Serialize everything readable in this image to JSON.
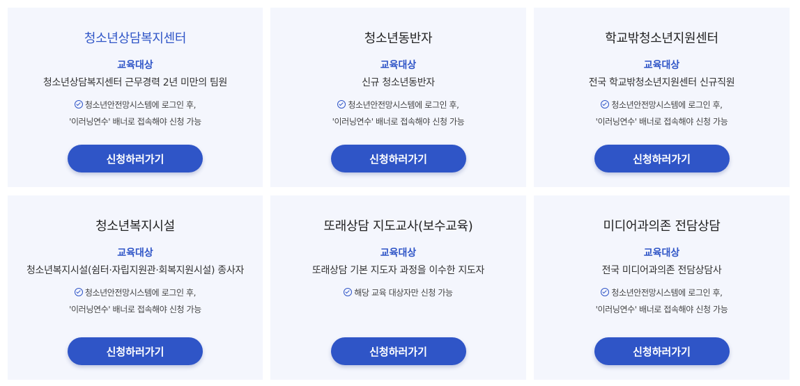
{
  "cards": [
    {
      "title": "청소년상담복지센터",
      "target_label": "교육대상",
      "target_desc": "청소년상담복지센터 근무경력 2년 미만의 팀원",
      "note_line1": "청소년안전망시스템에 로그인 후,",
      "note_line2": "'이러닝연수' 배너로 접속해야 신청 가능",
      "button": "신청하러가기"
    },
    {
      "title": "청소년동반자",
      "target_label": "교육대상",
      "target_desc": "신규 청소년동반자",
      "note_line1": "청소년안전망시스템에 로그인 후,",
      "note_line2": "'이러닝연수' 배너로 접속해야 신청 가능",
      "button": "신청하러가기"
    },
    {
      "title": "학교밖청소년지원센터",
      "target_label": "교육대상",
      "target_desc": "전국 학교밖청소년지원센터 신규직원",
      "note_line1": "청소년안전망시스템에 로그인 후,",
      "note_line2": "'이러닝연수' 배너로 접속해야 신청 가능",
      "button": "신청하러가기"
    },
    {
      "title": "청소년복지시설",
      "target_label": "교육대상",
      "target_desc": "청소년복지시설(쉼터·자립지원관·회복지원시설) 종사자",
      "note_line1": "청소년안전망시스템에 로그인 후,",
      "note_line2": "'이러닝연수' 배너로 접속해야 신청 가능",
      "button": "신청하러가기"
    },
    {
      "title": "또래상담 지도교사(보수교육)",
      "target_label": "교육대상",
      "target_desc": "또래상담 기본 지도자 과정을 이수한 지도자",
      "note_line1": "해당 교육 대상자만 신청 가능",
      "note_line2": "",
      "button": "신청하러가기"
    },
    {
      "title": "미디어과의존 전담상담",
      "target_label": "교육대상",
      "target_desc": "전국 미디어과의존 전담상담사",
      "note_line1": "청소년안전망시스템에 로그인 후,",
      "note_line2": "'이러닝연수' 배너로 접속해야 신청 가능",
      "button": "신청하러가기"
    }
  ],
  "colors": {
    "accent": "#2f55c7",
    "card_bg": "#f4f6fd",
    "button_text": "#ffffff"
  },
  "icons": {
    "note_icon": "check-circle-icon"
  }
}
